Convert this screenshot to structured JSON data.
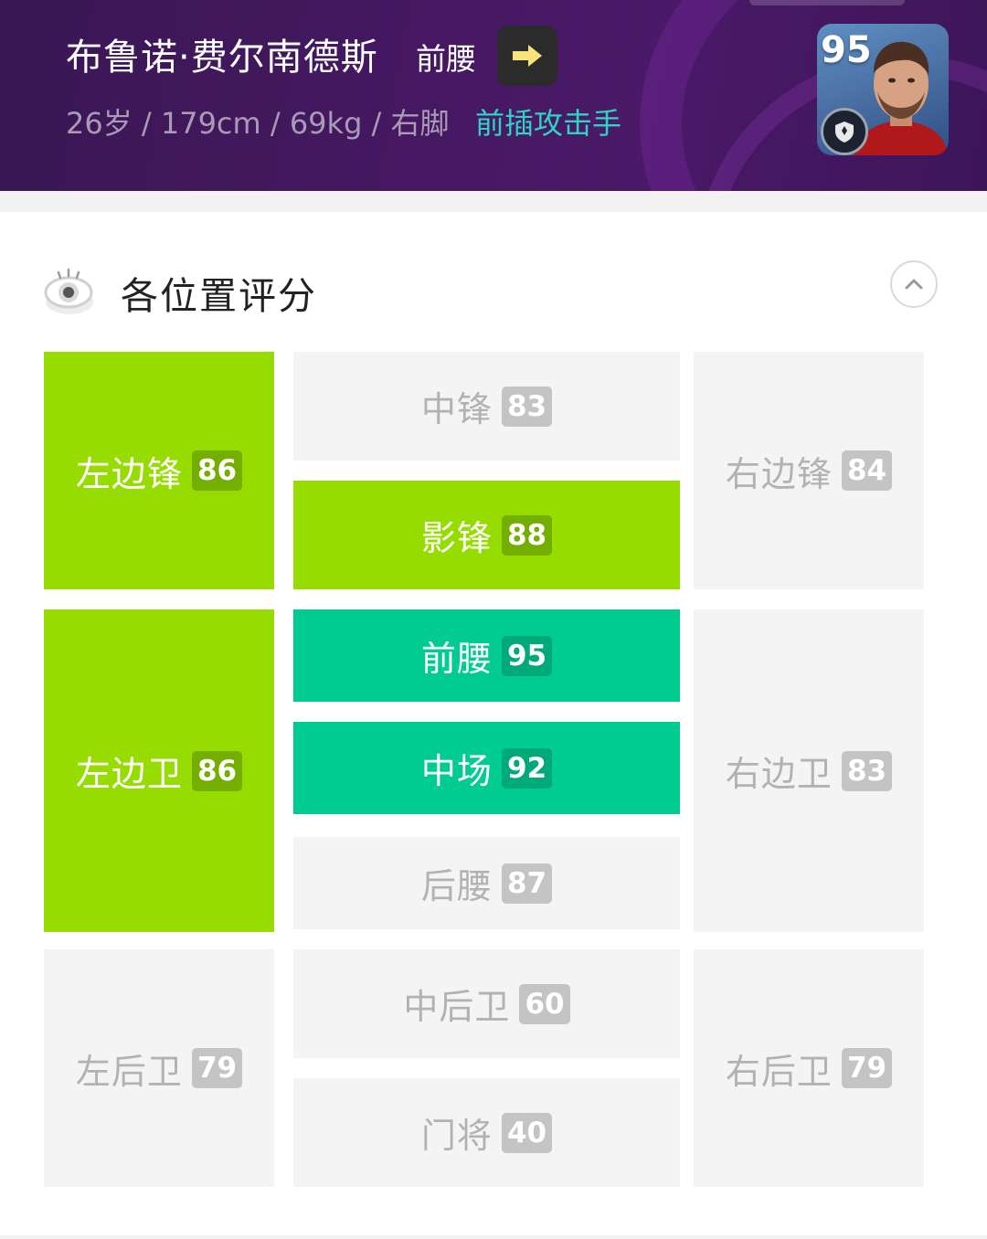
{
  "player": {
    "name": "布鲁诺·费尔南德斯",
    "position": "前腰",
    "info": "26岁 / 179cm / 69kg / 右脚",
    "play_style": "前插攻击手",
    "card_rating": "95"
  },
  "section": {
    "title": "各位置评分"
  },
  "positions": {
    "lwf": {
      "label": "左边锋",
      "rating": "86"
    },
    "cf": {
      "label": "中锋",
      "rating": "83"
    },
    "ss": {
      "label": "影锋",
      "rating": "88"
    },
    "rwf": {
      "label": "右边锋",
      "rating": "84"
    },
    "lmf": {
      "label": "左边卫",
      "rating": "86"
    },
    "amf": {
      "label": "前腰",
      "rating": "95"
    },
    "cmf": {
      "label": "中场",
      "rating": "92"
    },
    "dmf": {
      "label": "后腰",
      "rating": "87"
    },
    "rmf": {
      "label": "右边卫",
      "rating": "83"
    },
    "lb": {
      "label": "左后卫",
      "rating": "79"
    },
    "cb": {
      "label": "中后卫",
      "rating": "60"
    },
    "gk": {
      "label": "门将",
      "rating": "40"
    },
    "rb": {
      "label": "右后卫",
      "rating": "79"
    }
  },
  "colors": {
    "header_bg": "#461862",
    "play_style": "#2fd3c1",
    "best_fit": "#96dc00",
    "top_fit": "#00cc92",
    "inactive": "#f4f4f4"
  },
  "icons": {
    "switch": "arrow-right-icon",
    "section": "eye-icon",
    "collapse": "chevron-up-icon",
    "card_badge": "club-badge-icon"
  }
}
